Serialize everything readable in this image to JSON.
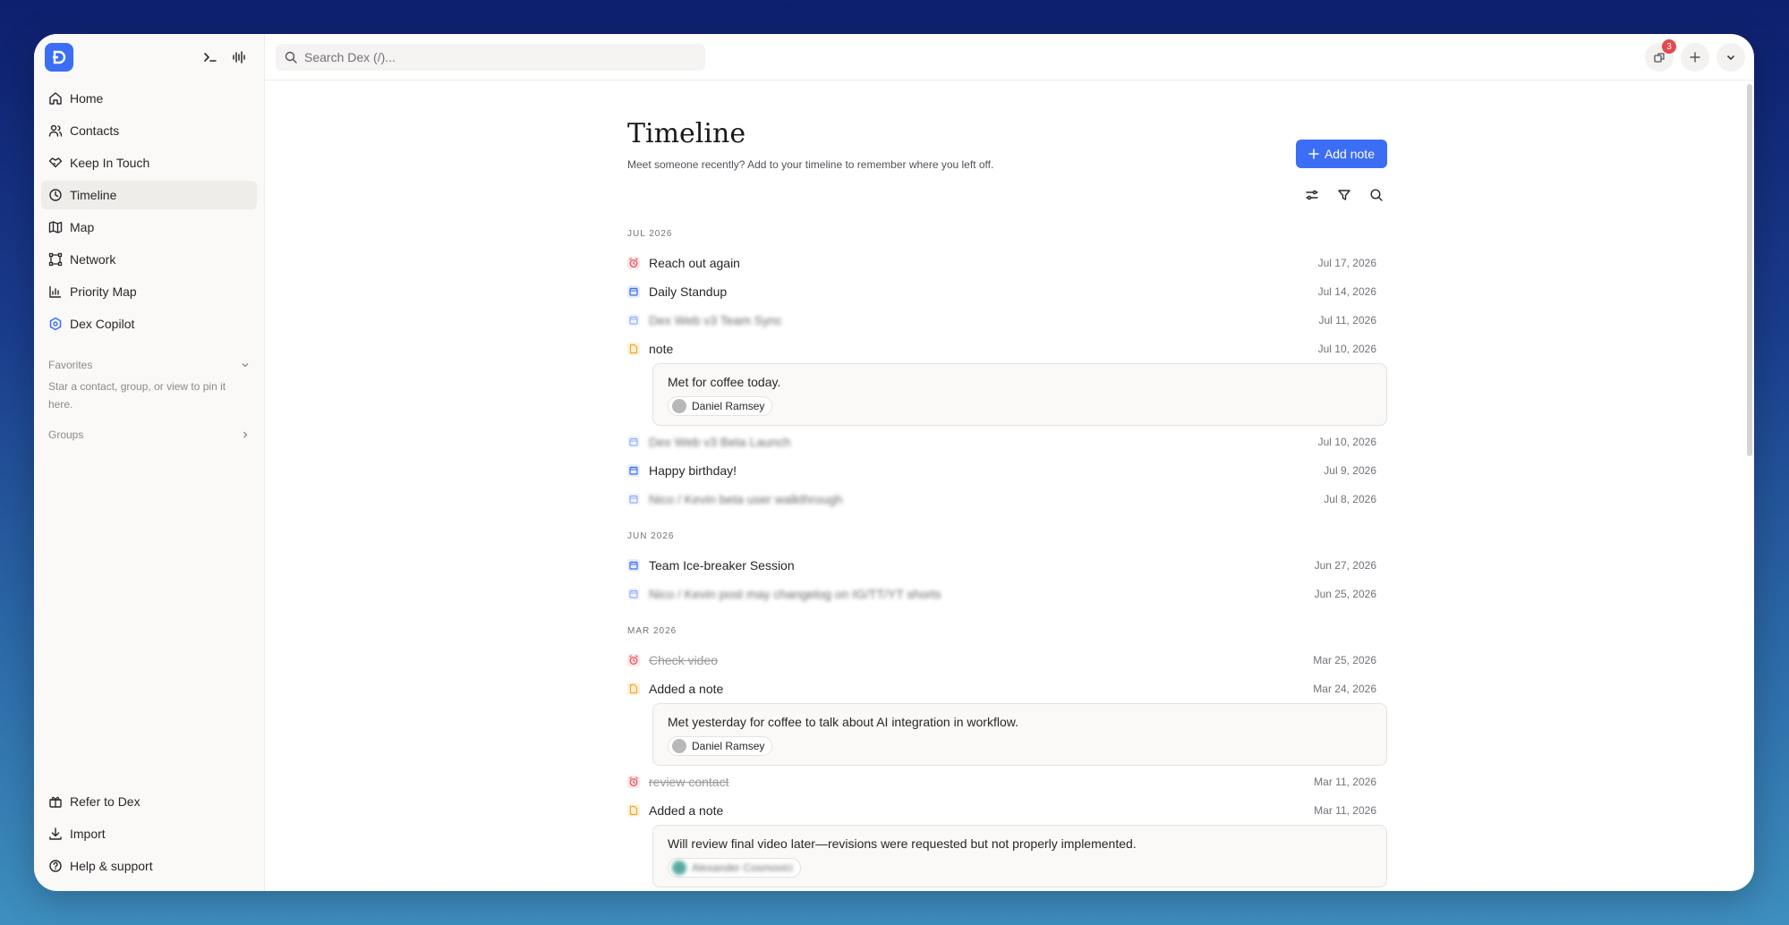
{
  "sidebar": {
    "nav": [
      {
        "label": "Home",
        "icon": "home-icon"
      },
      {
        "label": "Contacts",
        "icon": "users-icon"
      },
      {
        "label": "Keep In Touch",
        "icon": "handshake-icon"
      },
      {
        "label": "Timeline",
        "icon": "clock-icon"
      },
      {
        "label": "Map",
        "icon": "map-icon"
      },
      {
        "label": "Network",
        "icon": "network-icon"
      },
      {
        "label": "Priority Map",
        "icon": "chart-icon"
      },
      {
        "label": "Dex Copilot",
        "icon": "copilot-icon"
      }
    ],
    "favorites_label": "Favorites",
    "favorites_hint": "Star a contact, group, or view to pin it here.",
    "groups_label": "Groups",
    "bottom": [
      {
        "label": "Refer to Dex",
        "icon": "gift-icon"
      },
      {
        "label": "Import",
        "icon": "download-icon"
      },
      {
        "label": "Help & support",
        "icon": "help-icon"
      }
    ]
  },
  "topbar": {
    "search_placeholder": "Search Dex (/)...",
    "notification_count": "3"
  },
  "page": {
    "title": "Timeline",
    "subtitle": "Meet someone recently? Add to your timeline to remember where you left off.",
    "add_note_label": "Add note"
  },
  "months": [
    {
      "label": "JUL 2026",
      "entries": [
        {
          "type": "reminder",
          "title": "Reach out again",
          "date": "Jul 17, 2026"
        },
        {
          "type": "event",
          "title": "Daily Standup",
          "date": "Jul 14, 2026"
        },
        {
          "type": "event-blur",
          "title": "Dex Web v3 Team Sync",
          "date": "Jul 11, 2026",
          "blurred": true
        },
        {
          "type": "note",
          "title": "note",
          "date": "Jul 10, 2026",
          "note": {
            "text": "Met for coffee today.",
            "contact": "Daniel Ramsey"
          }
        },
        {
          "type": "event-blur",
          "title": "Dex Web v3 Beta Launch",
          "date": "Jul 10, 2026",
          "blurred": true
        },
        {
          "type": "event",
          "title": "Happy birthday!",
          "date": "Jul 9, 2026"
        },
        {
          "type": "event-blur",
          "title": "Nico / Kevin beta user walkthrough",
          "date": "Jul 8, 2026",
          "blurred": true
        }
      ]
    },
    {
      "label": "JUN 2026",
      "entries": [
        {
          "type": "event",
          "title": "Team Ice-breaker Session",
          "date": "Jun 27, 2026"
        },
        {
          "type": "event-blur",
          "title": "Nico / Kevin post may changelog on IG/TT/YT shorts",
          "date": "Jun 25, 2026",
          "blurred": true
        }
      ]
    },
    {
      "label": "MAR 2026",
      "entries": [
        {
          "type": "reminder",
          "title": "Check video",
          "date": "Mar 25, 2026",
          "done": true
        },
        {
          "type": "note",
          "title": "Added a note",
          "date": "Mar 24, 2026",
          "note": {
            "text": "Met yesterday for coffee to talk about AI integration in workflow.",
            "contact": "Daniel Ramsey"
          }
        },
        {
          "type": "reminder",
          "title": "review contact",
          "date": "Mar 11, 2026",
          "done": true
        },
        {
          "type": "note",
          "title": "Added a note",
          "date": "Mar 11, 2026",
          "note": {
            "text": "Will review final video later—revisions were requested but not properly implemented.",
            "contact": "Alexander Cosmovici",
            "blurred": true
          }
        }
      ]
    }
  ],
  "colors": {
    "accent": "#3b6ef5",
    "reminder": "#e5484d",
    "event": "#3b6ef5",
    "note": "#f5a524"
  }
}
